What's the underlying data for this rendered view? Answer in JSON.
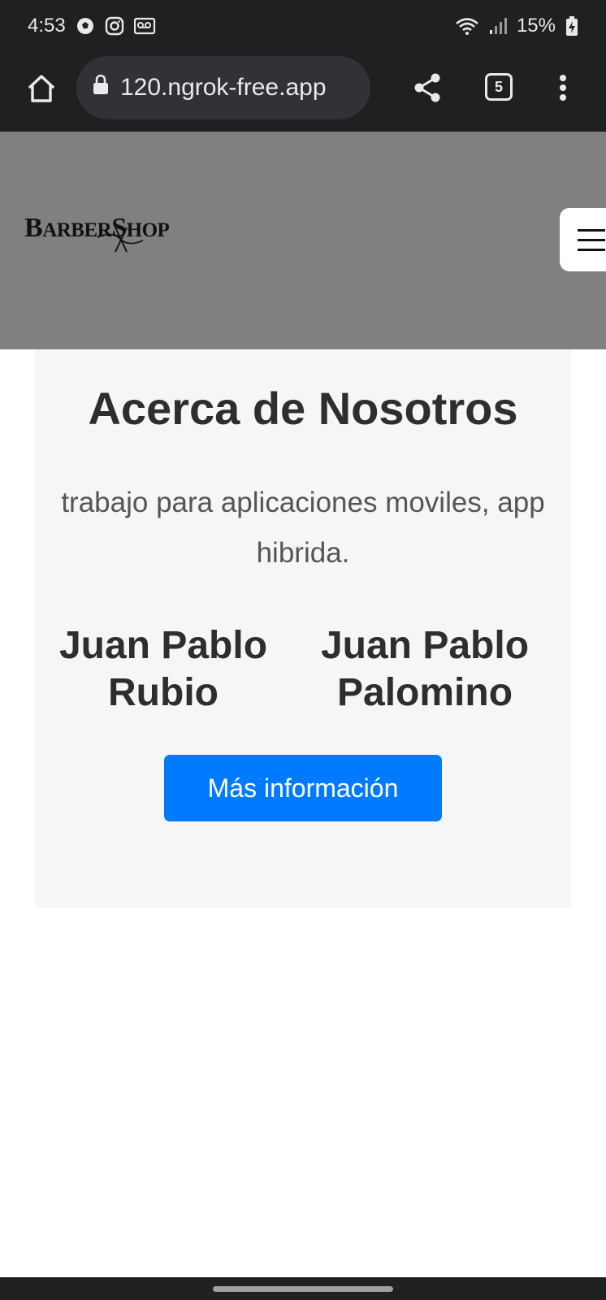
{
  "status_bar": {
    "time": "4:53",
    "battery": "15%",
    "icons_left": [
      "soccer-ball-icon",
      "instagram-icon",
      "voicemail-icon"
    ],
    "icons_right": [
      "wifi-icon",
      "signal-icon",
      "battery-charging-icon"
    ]
  },
  "browser": {
    "url": "120.ngrok-free.app",
    "tab_count": "5"
  },
  "site": {
    "logo_text_1": "B",
    "logo_text_2": "ARBER",
    "logo_text_3": "S",
    "logo_text_4": "HOP",
    "header_bg": "#808080"
  },
  "about": {
    "title": "Acerca de Nosotros",
    "description": "trabajo para aplicaciones moviles, app hibrida.",
    "members": [
      {
        "name": "Juan Pablo Rubio"
      },
      {
        "name": "Juan Pablo Palomino"
      }
    ],
    "button_label": "Más información",
    "button_color": "#007bff"
  }
}
